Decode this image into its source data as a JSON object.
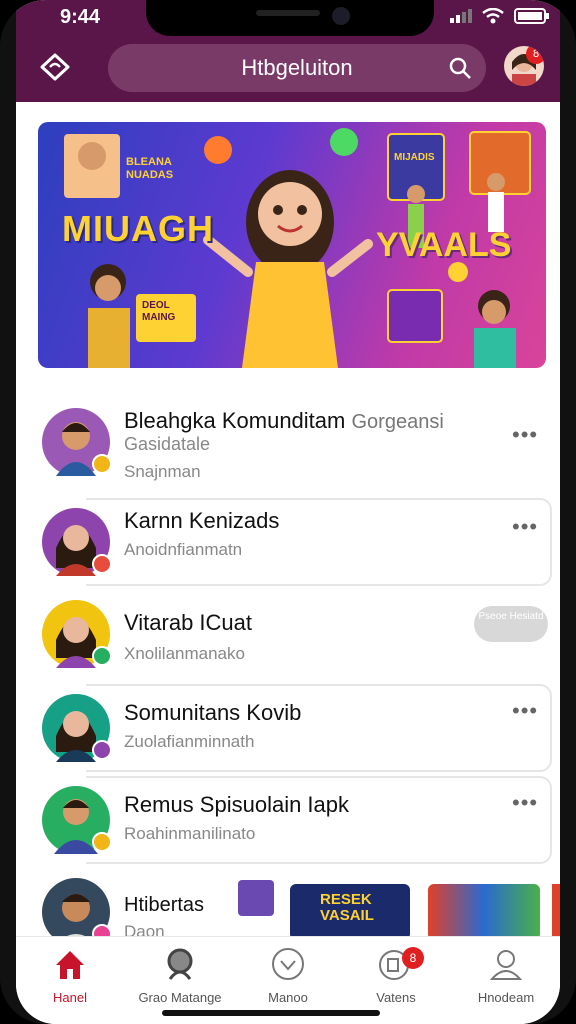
{
  "status": {
    "time": "9:44"
  },
  "header": {
    "title": "Htbgeluiton",
    "avatar_badge": "8"
  },
  "banner": {
    "title_left": "MIUAGH",
    "title_right": "YVAALS",
    "text_top": "BLEANA NUADAS",
    "text_right": "MIJADIS",
    "text_card": "DEOL MAING"
  },
  "rows": [
    {
      "name": "Bleahgka Komunditam",
      "name_extra": "Gorgeansi",
      "sub1": "Gasidatale",
      "sub": "Snajnman",
      "action": "•••",
      "status_color": "#f2b516",
      "avatar_bg": "#9b59b6"
    },
    {
      "name": "Karnn Kenizads",
      "sub": "Anoidnfianmatn",
      "action": "•••",
      "status_color": "#e74c3c",
      "avatar_bg": "#8e44ad"
    },
    {
      "name": "Vitarab ICuat",
      "sub": "Xnolilanmanako",
      "action_pill": "Pseoe Hesiatd",
      "status_color": "#27ae60",
      "avatar_bg": "#f1c40f"
    },
    {
      "name": "Somunitans Kovib",
      "sub": "Zuolafianminnath",
      "action": "•••",
      "status_color": "#8e44ad",
      "avatar_bg": "#16a085"
    },
    {
      "name": "Remus Spisuolain Iapk",
      "sub": "Roahinmanilinato",
      "action": "•••",
      "status_color": "#f2b516",
      "avatar_bg": "#27ae60"
    },
    {
      "name": "Htibertas",
      "sub": "Daon",
      "thumb_label": "RESEK VASAIL",
      "status_color": "#e84393",
      "avatar_bg": "#34495e"
    }
  ],
  "tabs": [
    {
      "label": "Hanel",
      "icon": "home-icon",
      "active": true
    },
    {
      "label": "Grao Matange",
      "icon": "group-icon"
    },
    {
      "label": "Manoo",
      "icon": "heart-icon"
    },
    {
      "label": "Vatens",
      "icon": "message-icon",
      "badge": "8"
    },
    {
      "label": "Hnodeam",
      "icon": "profile-icon"
    }
  ],
  "colors": {
    "accent": "#5a1648",
    "active_tab": "#c8142a"
  }
}
